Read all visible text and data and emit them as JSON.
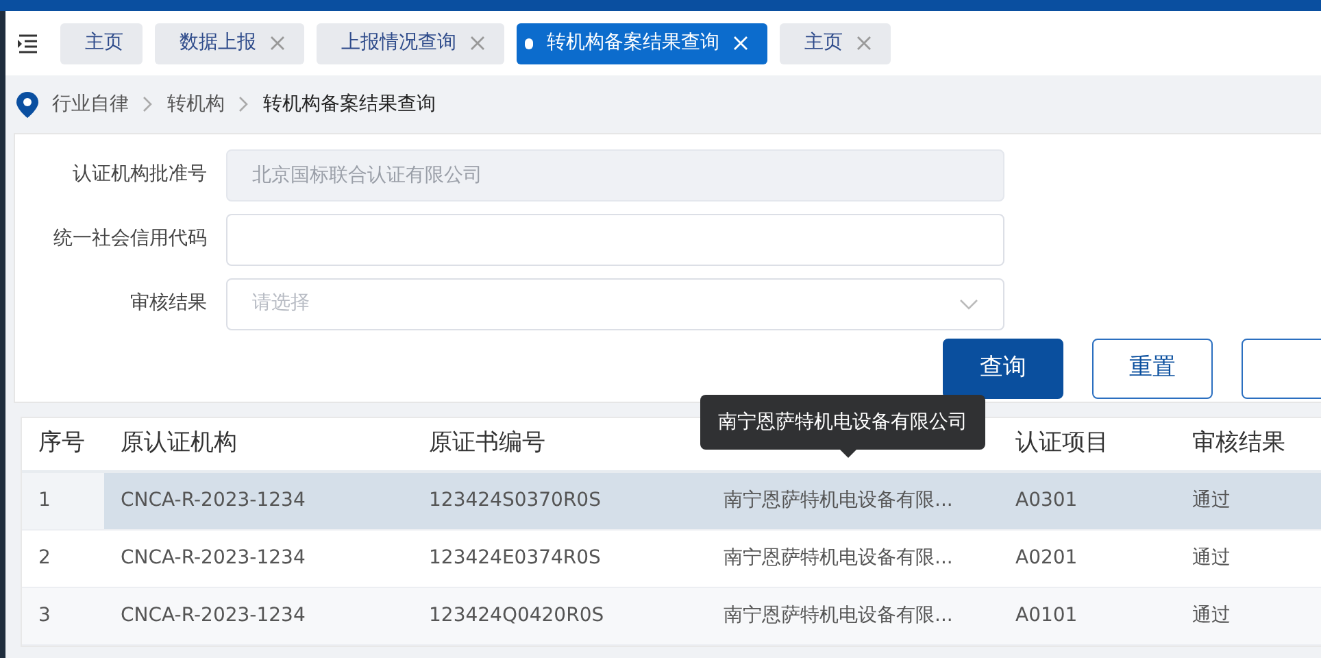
{
  "tabs": [
    {
      "label": "主页",
      "selected": false,
      "closable": false
    },
    {
      "label": "数据上报",
      "selected": false,
      "closable": true
    },
    {
      "label": "上报情况查询",
      "selected": false,
      "closable": true
    },
    {
      "label": "转机构备案结果查询",
      "selected": true,
      "closable": true
    },
    {
      "label": "主页",
      "selected": false,
      "closable": true
    }
  ],
  "breadcrumb": [
    "行业自律",
    "转机构",
    "转机构备案结果查询"
  ],
  "form": {
    "fields": [
      {
        "label": "认证机构批准号",
        "kind": "text",
        "value": "北京国标联合认证有限公司",
        "disabled": true
      },
      {
        "label": "统一社会信用代码",
        "kind": "text",
        "disabled": false
      },
      {
        "label": "审核结果",
        "kind": "select",
        "placeholder": "请选择",
        "disabled": false
      }
    ],
    "buttons": [
      {
        "label": "查询",
        "kind": "primary"
      },
      {
        "label": "重置",
        "kind": "outline"
      },
      {
        "kind": "outline"
      }
    ]
  },
  "table": {
    "columns": [
      "序号",
      "原认证机构",
      "原证书编号",
      null,
      "认证项目",
      "审核结果"
    ],
    "rows": [
      {
        "selected": true,
        "cells": [
          "1",
          "CNCA-R-2023-1234",
          "123424S0370R0S",
          "南宁恩萨特机电设备有限...",
          "A0301",
          "通过"
        ]
      },
      {
        "selected": false,
        "cells": [
          "2",
          "CNCA-R-2023-1234",
          "123424E0374R0S",
          "南宁恩萨特机电设备有限...",
          "A0201",
          "通过"
        ]
      },
      {
        "selected": false,
        "cells": [
          "3",
          "CNCA-R-2023-1234",
          "123424Q0420R0S",
          "南宁恩萨特机电设备有限...",
          "A0101",
          "通过"
        ]
      }
    ]
  },
  "tooltip": {
    "text": "南宁恩萨特机电设备有限公司"
  }
}
